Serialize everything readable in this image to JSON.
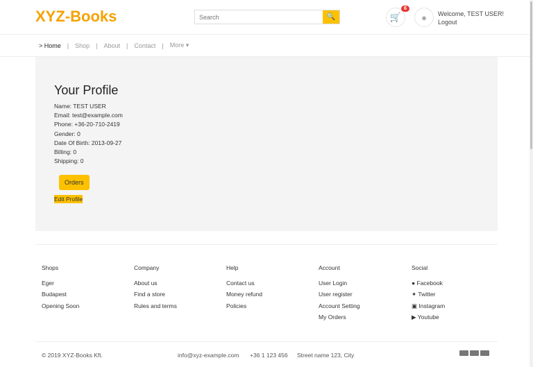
{
  "header": {
    "logo": "XYZ-Books",
    "search_placeholder": "Search",
    "cart_count": "6",
    "welcome": "Welcome, TEST USER!",
    "logout": "Logout"
  },
  "nav": {
    "items": [
      "> Home",
      "Shop",
      "About",
      "Contact",
      "More ▾"
    ]
  },
  "profile": {
    "title": "Your Profile",
    "fields": [
      "Name: TEST USER",
      "Email: test@example.com",
      "Phone: +36-20-710-2419",
      "Gender: 0",
      "Date Of Birth: 2013-09-27",
      "Billing: 0",
      "Shipping: 0"
    ],
    "orders": "Orders",
    "edit": "Edit Profile"
  },
  "footer": {
    "columns": [
      {
        "title": "Shops",
        "items": [
          "Eger",
          "Budapest",
          "Opening Soon"
        ]
      },
      {
        "title": "Company",
        "items": [
          "About us",
          "Find a store",
          "Rules and terms"
        ]
      },
      {
        "title": "Help",
        "items": [
          "Contact us",
          "Money refund",
          "Policies"
        ]
      },
      {
        "title": "Account",
        "items": [
          "User Login",
          "User register",
          "Account Setting",
          "My Orders"
        ]
      },
      {
        "title": "Social",
        "items": [
          "Facebook",
          "Twitter",
          "Instagram",
          "Youtube"
        ]
      }
    ],
    "copyright": "© 2019 XYZ-Books Kft.",
    "email": "info@xyz-example.com",
    "phone": "+36 1 123 456",
    "address": "Street name 123, City"
  }
}
